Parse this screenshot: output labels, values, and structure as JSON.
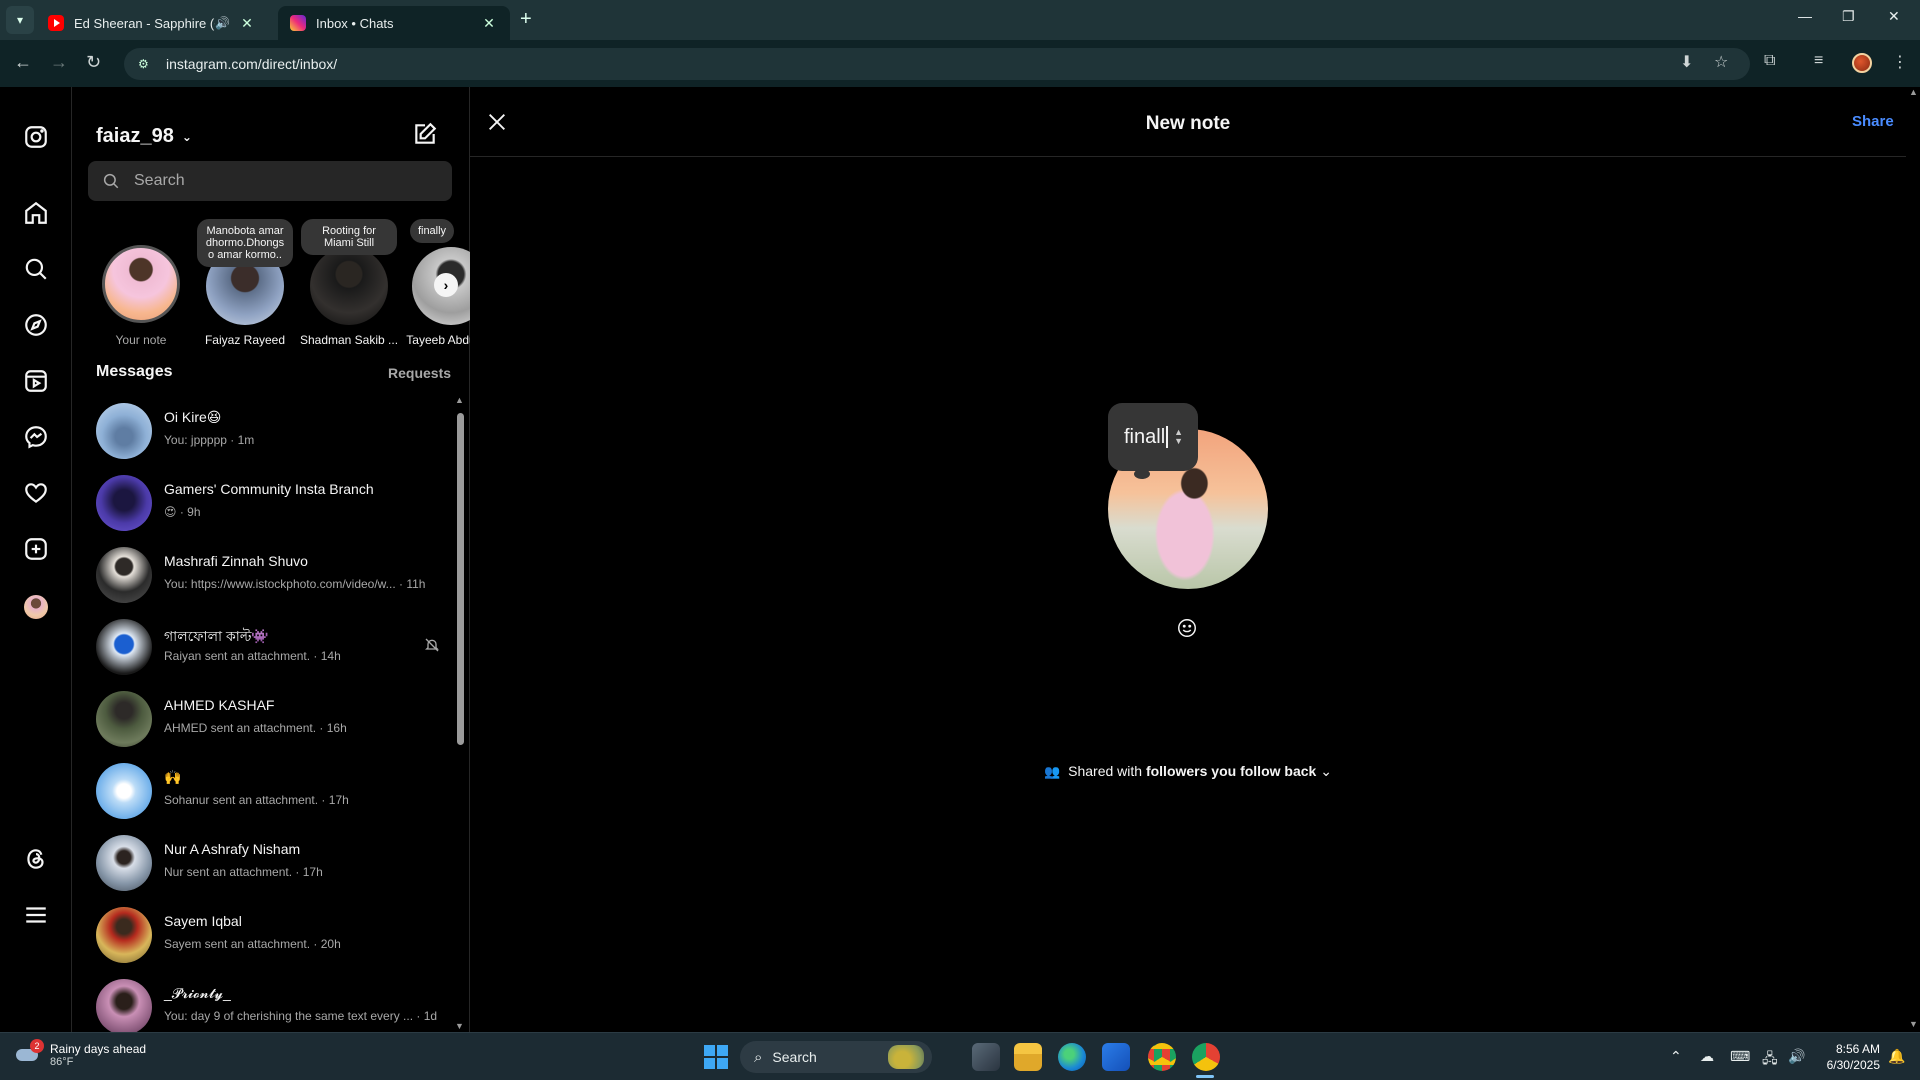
{
  "browser": {
    "tabs": [
      {
        "title": "Ed Sheeran - Sapphire (Offi",
        "favicon": "youtube-icon",
        "audio": true,
        "active": false
      },
      {
        "title": "Inbox • Chats",
        "favicon": "instagram-icon",
        "active": true
      }
    ],
    "url": "instagram.com/direct/inbox/"
  },
  "sidebar_nav": [
    "instagram-logo",
    "home",
    "search",
    "explore",
    "reels",
    "messages",
    "notifications",
    "create",
    "profile",
    "threads",
    "more"
  ],
  "inbox": {
    "username": "faiaz_98",
    "search_placeholder": "Search",
    "notes": [
      {
        "bubble": "",
        "name": "Your note",
        "muted": true
      },
      {
        "bubble": "Manobota amar dhormo.Dhongs o amar kormo..",
        "name": "Faiyaz Rayeed"
      },
      {
        "bubble": "Rooting for Miami Still",
        "name": "Shadman Sakib ..."
      },
      {
        "bubble": "finally",
        "name": "Tayeeb Abdu"
      }
    ],
    "messages_header": "Messages",
    "requests_label": "Requests",
    "conversations": [
      {
        "name": "Oi Kire😆",
        "sub": "You: jppppp · 1m",
        "muted": false
      },
      {
        "name": "Gamers' Community Insta Branch",
        "sub": "😍 · 9h",
        "muted": false
      },
      {
        "name": "Mashrafi Zinnah Shuvo",
        "sub": "You: https://www.istockphoto.com/video/w... · 11h",
        "muted": false
      },
      {
        "name": "গালফোলা কাল্ট👾",
        "sub": "Raiyan sent an attachment. · 14h",
        "muted": true
      },
      {
        "name": "AHMED KASHAF",
        "sub": "AHMED sent an attachment. · 16h",
        "muted": false
      },
      {
        "name": "🙌",
        "sub": "Sohanur sent an attachment. · 17h",
        "muted": false
      },
      {
        "name": "Nur A Ashrafy Nisham",
        "sub": "Nur sent an attachment. · 17h",
        "muted": false
      },
      {
        "name": "Sayem Iqbal",
        "sub": "Sayem sent an attachment. · 20h",
        "muted": false
      },
      {
        "name": "_𝓟𝓻𝓲𝓸𝓷𝓽𝔂_",
        "sub": "You: day 9 of cherishing the same text every ... · 1d",
        "muted": false
      }
    ]
  },
  "note_panel": {
    "title": "New note",
    "share_label": "Share",
    "note_text": "finall",
    "audience_prefix": "Shared with",
    "audience_value": "followers you follow back"
  },
  "taskbar": {
    "weather_title": "Rainy days ahead",
    "weather_temp": "86°F",
    "weather_badge": "2",
    "search_label": "Search",
    "time": "8:56 AM",
    "date": "6/30/2025"
  },
  "colors": {
    "accent_blue": "#4a8cff",
    "background": "#000000",
    "surface": "#262626",
    "note_bubble": "#363636",
    "chrome_frame": "#1f3438"
  }
}
